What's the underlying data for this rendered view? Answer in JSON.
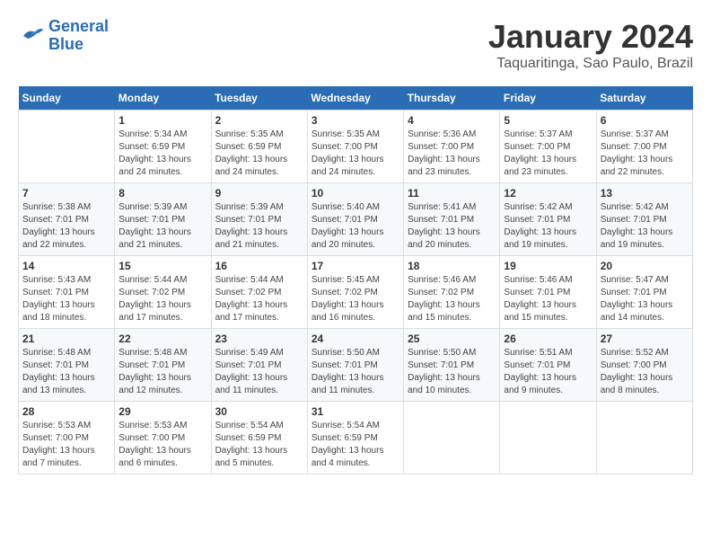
{
  "header": {
    "logo_line1": "General",
    "logo_line2": "Blue",
    "month_title": "January 2024",
    "location": "Taquaritinga, Sao Paulo, Brazil"
  },
  "days_of_week": [
    "Sunday",
    "Monday",
    "Tuesday",
    "Wednesday",
    "Thursday",
    "Friday",
    "Saturday"
  ],
  "weeks": [
    [
      {
        "day": "",
        "info": ""
      },
      {
        "day": "1",
        "info": "Sunrise: 5:34 AM\nSunset: 6:59 PM\nDaylight: 13 hours\nand 24 minutes."
      },
      {
        "day": "2",
        "info": "Sunrise: 5:35 AM\nSunset: 6:59 PM\nDaylight: 13 hours\nand 24 minutes."
      },
      {
        "day": "3",
        "info": "Sunrise: 5:35 AM\nSunset: 7:00 PM\nDaylight: 13 hours\nand 24 minutes."
      },
      {
        "day": "4",
        "info": "Sunrise: 5:36 AM\nSunset: 7:00 PM\nDaylight: 13 hours\nand 23 minutes."
      },
      {
        "day": "5",
        "info": "Sunrise: 5:37 AM\nSunset: 7:00 PM\nDaylight: 13 hours\nand 23 minutes."
      },
      {
        "day": "6",
        "info": "Sunrise: 5:37 AM\nSunset: 7:00 PM\nDaylight: 13 hours\nand 22 minutes."
      }
    ],
    [
      {
        "day": "7",
        "info": "Sunrise: 5:38 AM\nSunset: 7:01 PM\nDaylight: 13 hours\nand 22 minutes."
      },
      {
        "day": "8",
        "info": "Sunrise: 5:39 AM\nSunset: 7:01 PM\nDaylight: 13 hours\nand 21 minutes."
      },
      {
        "day": "9",
        "info": "Sunrise: 5:39 AM\nSunset: 7:01 PM\nDaylight: 13 hours\nand 21 minutes."
      },
      {
        "day": "10",
        "info": "Sunrise: 5:40 AM\nSunset: 7:01 PM\nDaylight: 13 hours\nand 20 minutes."
      },
      {
        "day": "11",
        "info": "Sunrise: 5:41 AM\nSunset: 7:01 PM\nDaylight: 13 hours\nand 20 minutes."
      },
      {
        "day": "12",
        "info": "Sunrise: 5:42 AM\nSunset: 7:01 PM\nDaylight: 13 hours\nand 19 minutes."
      },
      {
        "day": "13",
        "info": "Sunrise: 5:42 AM\nSunset: 7:01 PM\nDaylight: 13 hours\nand 19 minutes."
      }
    ],
    [
      {
        "day": "14",
        "info": "Sunrise: 5:43 AM\nSunset: 7:01 PM\nDaylight: 13 hours\nand 18 minutes."
      },
      {
        "day": "15",
        "info": "Sunrise: 5:44 AM\nSunset: 7:02 PM\nDaylight: 13 hours\nand 17 minutes."
      },
      {
        "day": "16",
        "info": "Sunrise: 5:44 AM\nSunset: 7:02 PM\nDaylight: 13 hours\nand 17 minutes."
      },
      {
        "day": "17",
        "info": "Sunrise: 5:45 AM\nSunset: 7:02 PM\nDaylight: 13 hours\nand 16 minutes."
      },
      {
        "day": "18",
        "info": "Sunrise: 5:46 AM\nSunset: 7:02 PM\nDaylight: 13 hours\nand 15 minutes."
      },
      {
        "day": "19",
        "info": "Sunrise: 5:46 AM\nSunset: 7:01 PM\nDaylight: 13 hours\nand 15 minutes."
      },
      {
        "day": "20",
        "info": "Sunrise: 5:47 AM\nSunset: 7:01 PM\nDaylight: 13 hours\nand 14 minutes."
      }
    ],
    [
      {
        "day": "21",
        "info": "Sunrise: 5:48 AM\nSunset: 7:01 PM\nDaylight: 13 hours\nand 13 minutes."
      },
      {
        "day": "22",
        "info": "Sunrise: 5:48 AM\nSunset: 7:01 PM\nDaylight: 13 hours\nand 12 minutes."
      },
      {
        "day": "23",
        "info": "Sunrise: 5:49 AM\nSunset: 7:01 PM\nDaylight: 13 hours\nand 11 minutes."
      },
      {
        "day": "24",
        "info": "Sunrise: 5:50 AM\nSunset: 7:01 PM\nDaylight: 13 hours\nand 11 minutes."
      },
      {
        "day": "25",
        "info": "Sunrise: 5:50 AM\nSunset: 7:01 PM\nDaylight: 13 hours\nand 10 minutes."
      },
      {
        "day": "26",
        "info": "Sunrise: 5:51 AM\nSunset: 7:01 PM\nDaylight: 13 hours\nand 9 minutes."
      },
      {
        "day": "27",
        "info": "Sunrise: 5:52 AM\nSunset: 7:00 PM\nDaylight: 13 hours\nand 8 minutes."
      }
    ],
    [
      {
        "day": "28",
        "info": "Sunrise: 5:53 AM\nSunset: 7:00 PM\nDaylight: 13 hours\nand 7 minutes."
      },
      {
        "day": "29",
        "info": "Sunrise: 5:53 AM\nSunset: 7:00 PM\nDaylight: 13 hours\nand 6 minutes."
      },
      {
        "day": "30",
        "info": "Sunrise: 5:54 AM\nSunset: 6:59 PM\nDaylight: 13 hours\nand 5 minutes."
      },
      {
        "day": "31",
        "info": "Sunrise: 5:54 AM\nSunset: 6:59 PM\nDaylight: 13 hours\nand 4 minutes."
      },
      {
        "day": "",
        "info": ""
      },
      {
        "day": "",
        "info": ""
      },
      {
        "day": "",
        "info": ""
      }
    ]
  ]
}
